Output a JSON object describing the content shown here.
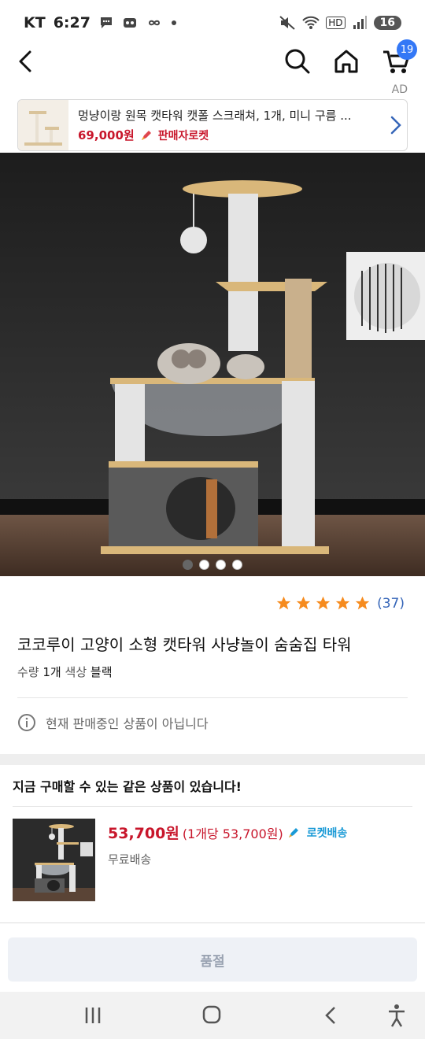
{
  "status": {
    "carrier": "KT",
    "time": "6:27",
    "hd": "HD",
    "battery": "16"
  },
  "nav": {
    "cart_count": "19"
  },
  "ad": {
    "label": "AD",
    "title": "멍냥이랑 원목 캣타워 캣폴 스크래쳐, 1개, 미니 구름 ...",
    "price": "69,000원",
    "tag": "판매자로켓"
  },
  "gallery": {
    "total": 4,
    "active_index": 0
  },
  "product": {
    "rating_stars": 5,
    "rating_count": "(37)",
    "title": "코코루이 고양이 소형 캣타워 사냥놀이 숨숨집 타워",
    "qty_label": "수량",
    "qty_value": "1개",
    "color_label": "색상",
    "color_value": "블랙",
    "notice": "현재 판매중인 상품이 아닙니다"
  },
  "same_product": {
    "header": "지금 구매할 수 있는 같은 상품이 있습니다!",
    "price": "53,700원",
    "unit_price": "(1개당 53,700원)",
    "tag": "로켓배송",
    "shipping": "무료배송"
  },
  "bottom": {
    "button_label": "품절"
  },
  "colors": {
    "price_red": "#c8162b",
    "link_blue": "#3565b8",
    "star": "#f68b1e",
    "rocket_blue": "#1a9ad6"
  }
}
